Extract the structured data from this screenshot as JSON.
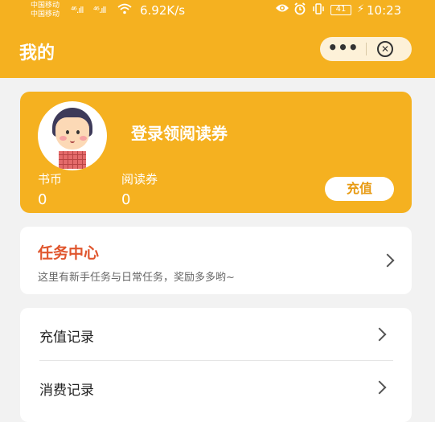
{
  "status_bar": {
    "carrier_1": "中国移动",
    "carrier_2": "中国移动",
    "signal_1": "⁴⁶.ıll",
    "signal_2": "⁴⁶.ıll",
    "net_speed": "6.92K/s",
    "battery": "41",
    "time": "10:23"
  },
  "header": {
    "title": "我的",
    "more_label": "•••",
    "close_label": "✕"
  },
  "profile": {
    "login_text": "登录领阅读券",
    "stats": [
      {
        "label": "书币",
        "value": "0"
      },
      {
        "label": "阅读券",
        "value": "0"
      }
    ],
    "recharge_label": "充值"
  },
  "task_card": {
    "title": "任务中心",
    "subtitle": "这里有新手任务与日常任务，奖励多多哟~"
  },
  "menu": {
    "items": [
      {
        "label": "充值记录"
      },
      {
        "label": "消费记录"
      }
    ]
  },
  "colors": {
    "brand": "#f5b120",
    "task_title": "#e0562e",
    "background": "#f2f2f2"
  }
}
